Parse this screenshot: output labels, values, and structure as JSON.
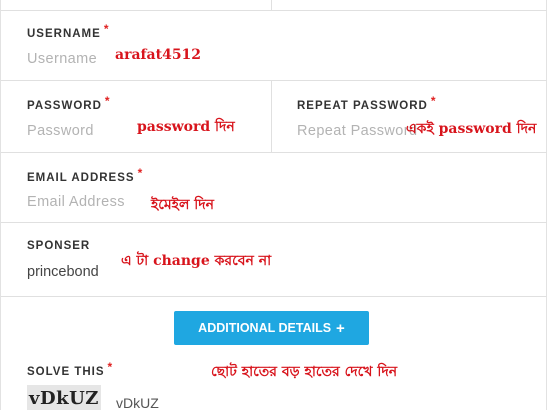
{
  "form": {
    "username": {
      "label": "USERNAME",
      "required_mark": "*",
      "placeholder": "Username",
      "note": "arafat4512"
    },
    "password": {
      "label": "PASSWORD",
      "required_mark": "*",
      "placeholder": "Password",
      "note": "password দিন"
    },
    "repeat_password": {
      "label": "REPEAT PASSWORD",
      "required_mark": "*",
      "placeholder": "Repeat Password",
      "note": "একই password দিন"
    },
    "email": {
      "label": "EMAIL ADDRESS",
      "required_mark": "*",
      "placeholder": "Email Address",
      "note": "ইমেইল দিন"
    },
    "sponser": {
      "label": "SPONSER",
      "value": "princebond",
      "note": "এ টা change করবেন না"
    },
    "additional_details_button": {
      "label": "ADDITIONAL DETAILS",
      "icon": "plus-icon",
      "color": "#1fa7e1"
    },
    "solve_this": {
      "label": "SOLVE THIS",
      "required_mark": "*",
      "captcha_image_text": "vDkUZ",
      "captcha_value": "vDkUZ",
      "note": "ছোট হাতের বড় হাতের দেখে দিন"
    }
  },
  "colors": {
    "required": "#e02020",
    "note": "#d8141c",
    "button": "#1fa7e1"
  }
}
